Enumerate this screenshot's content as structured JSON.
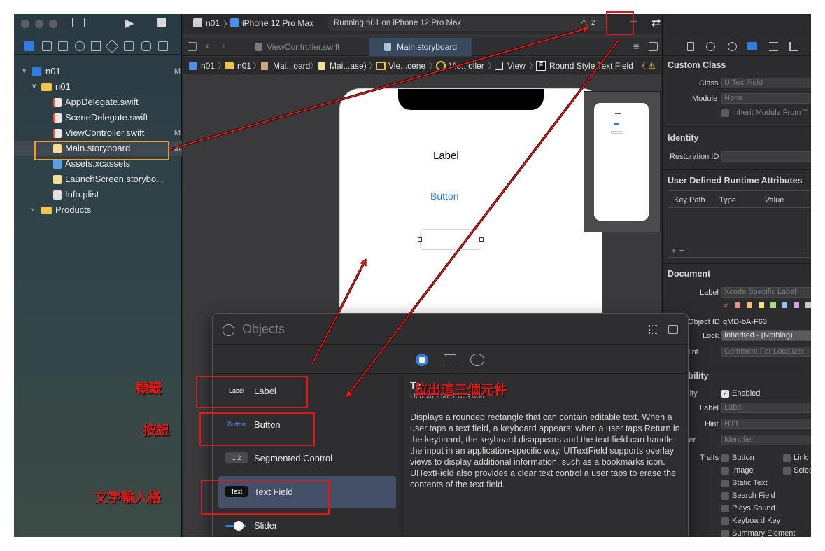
{
  "navigator": {
    "project_name": "n01",
    "project_badge": "M",
    "group_name": "n01",
    "files": [
      {
        "name": "AppDelegate.swift",
        "badge": ""
      },
      {
        "name": "SceneDelegate.swift",
        "badge": ""
      },
      {
        "name": "ViewController.swift",
        "badge": "M"
      },
      {
        "name": "Main.storyboard",
        "badge": "M"
      },
      {
        "name": "Assets.xcassets",
        "badge": ""
      },
      {
        "name": "LaunchScreen.storybo...",
        "badge": ""
      },
      {
        "name": "Info.plist",
        "badge": ""
      }
    ],
    "products": "Products"
  },
  "toolbar": {
    "scheme": "n01",
    "device": "iPhone 12 Pro Max",
    "status": "Running n01 on iPhone 12 Pro Max",
    "warning_count": "2",
    "add_symbol": "+",
    "swap_symbol": "⇄"
  },
  "tabs": {
    "tab1": "ViewController.swift",
    "tab2": "Main.storyboard"
  },
  "jumpbar": [
    "n01",
    "n01",
    "Mai...oard",
    "Mai...ase)",
    "Vie...cene",
    "Vie...oller",
    "View",
    "Round Style Text Field"
  ],
  "canvas": {
    "label_text": "Label",
    "button_text": "Button"
  },
  "inspector": {
    "custom_class": "Custom Class",
    "class_label": "Class",
    "class_value": "UITextField",
    "module_label": "Module",
    "module_value": "None",
    "inherit_module": "Inherit Module From T",
    "identity": "Identity",
    "restoration_id": "Restoration ID",
    "udra": "User Defined Runtime Attributes",
    "col_keypath": "Key Path",
    "col_type": "Type",
    "col_value": "Value",
    "add_remove": "+  −",
    "document": "Document",
    "doc_label": "Label",
    "doc_label_placeholder": "Xcode Specific Label",
    "object_id_label": "Object ID",
    "object_id_value": "qMD-bA-F63",
    "lock_label": "Lock",
    "lock_value": "Inherited - (Nothing)",
    "localizer_hint_label": "lizer Hint",
    "localizer_hint_placeholder": "Comment For Localizer",
    "accessibility": "essibility",
    "acc_label": "essibility",
    "acc_enabled": "Enabled",
    "acc_label_label": "Label",
    "acc_label_placeholder": "Label",
    "hint_label": "Hint",
    "hint_placeholder": "Hint",
    "identifier_label": "dentifier",
    "identifier_placeholder": "Identifier",
    "traits_label": "Traits",
    "traits": [
      "Button",
      "Image",
      "Static Text",
      "Search Field",
      "Plays Sound",
      "Keyboard Key",
      "Summary Element"
    ],
    "traits_col2": [
      "Link",
      "Selec"
    ]
  },
  "library": {
    "search_placeholder": "Objects",
    "items": [
      {
        "thumb": "Label",
        "name": "Label"
      },
      {
        "thumb": "Button",
        "name": "Button"
      },
      {
        "thumb": "1  2",
        "name": "Segmented Control"
      },
      {
        "thumb": "Text",
        "name": "Text Field"
      },
      {
        "thumb": "",
        "name": "Slider"
      }
    ],
    "detail_title": "Te",
    "detail_subtitle": "UITextField: Edits text",
    "detail_body": "Displays a rounded rectangle that can contain editable text. When a user taps a text field, a keyboard appears; when a user taps Return in the keyboard, the keyboard disappears and the text field can handle the input in an application-specific way. UITextField supports overlay views to display additional information, such as a bookmarks icon. UITextField also provides a clear text control a user taps to erase the contents of the text field."
  },
  "annotations": {
    "label_cn": "標籤",
    "button_cn": "按鈕",
    "textfield_cn": "文字輸入格",
    "drag_cn": "拉出這三個元件"
  },
  "colors": {
    "annotation_red": "#e01818",
    "accent_blue": "#2f7de1",
    "selection_blue": "#435067"
  }
}
